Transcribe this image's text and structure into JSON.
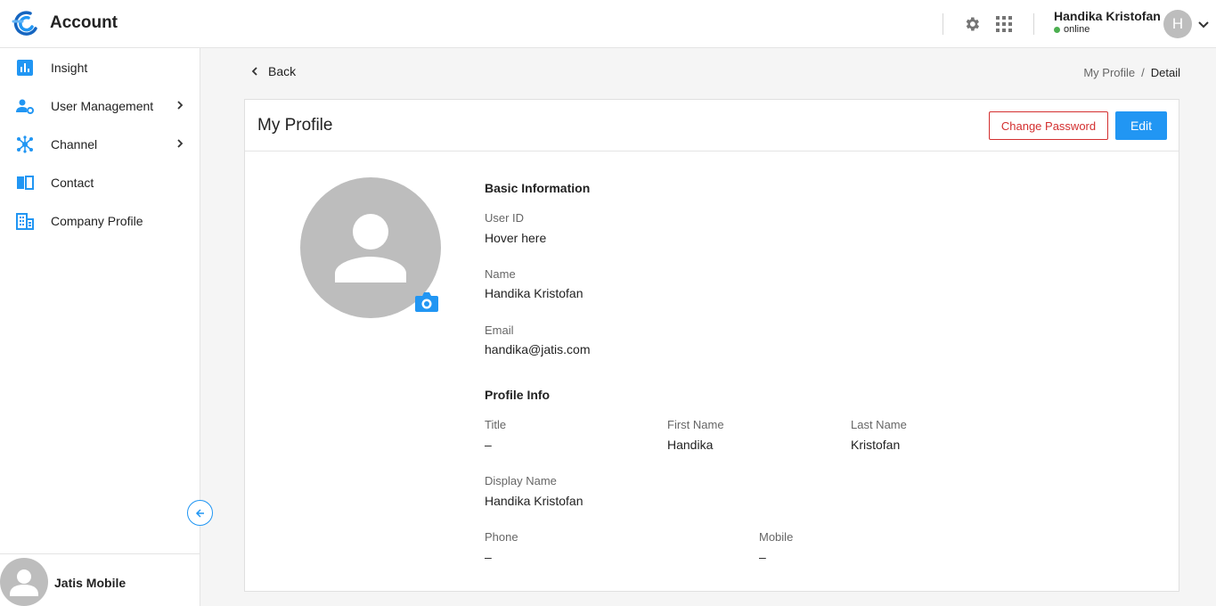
{
  "header": {
    "app_title": "Account",
    "user_name": "Handika Kristofan",
    "status": "online",
    "avatar_initial": "H",
    "status_color": "#4caf50"
  },
  "sidebar": {
    "items": [
      {
        "label": "Insight",
        "icon": "bar-chart-icon"
      },
      {
        "label": "User Management",
        "icon": "user-gear-icon"
      },
      {
        "label": "Channel",
        "icon": "hub-icon"
      },
      {
        "label": "Contact",
        "icon": "book-icon"
      },
      {
        "label": "Company Profile",
        "icon": "building-icon"
      }
    ],
    "org_name": "Jatis Mobile"
  },
  "nav": {
    "back_label": "Back",
    "breadcrumb": [
      "My Profile",
      "/",
      "Detail"
    ]
  },
  "card": {
    "title": "My Profile",
    "change_password_label": "Change Password",
    "edit_label": "Edit"
  },
  "basic": {
    "heading": "Basic Information",
    "user_id_label": "User ID",
    "user_id_value": "Hover here",
    "name_label": "Name",
    "name_value": "Handika Kristofan",
    "email_label": "Email",
    "email_value": "handika@jatis.com"
  },
  "profile": {
    "heading": "Profile Info",
    "title_label": "Title",
    "title_value": "–",
    "first_name_label": "First Name",
    "first_name_value": "Handika",
    "last_name_label": "Last Name",
    "last_name_value": "Kristofan",
    "display_name_label": "Display Name",
    "display_name_value": "Handika Kristofan",
    "phone_label": "Phone",
    "phone_value": "–",
    "mobile_label": "Mobile",
    "mobile_value": "–"
  },
  "colors": {
    "accent": "#2196f3",
    "danger": "#d32f2f",
    "avatar_gray": "#bdbdbd"
  }
}
